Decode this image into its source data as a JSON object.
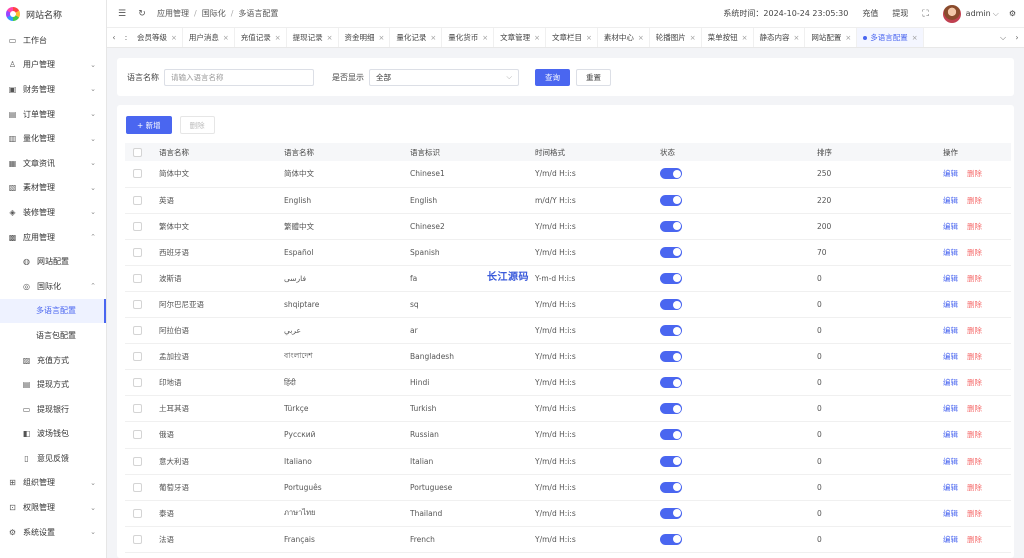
{
  "site_name": "网站名称",
  "sidebar": {
    "items": [
      {
        "label": "工作台",
        "icon": "desktop-icon",
        "glyph": "▭",
        "level": 0
      },
      {
        "label": "用户管理",
        "icon": "user-icon",
        "glyph": "♙",
        "level": 0,
        "arrow": "down"
      },
      {
        "label": "财务管理",
        "icon": "wallet-icon",
        "glyph": "▣",
        "level": 0,
        "arrow": "down"
      },
      {
        "label": "订单管理",
        "icon": "order-icon",
        "glyph": "▤",
        "level": 0,
        "arrow": "down"
      },
      {
        "label": "量化管理",
        "icon": "chart-icon",
        "glyph": "▥",
        "level": 0,
        "arrow": "down"
      },
      {
        "label": "文章资讯",
        "icon": "article-icon",
        "glyph": "▦",
        "level": 0,
        "arrow": "down"
      },
      {
        "label": "素材管理",
        "icon": "image-icon",
        "glyph": "▧",
        "level": 0,
        "arrow": "down"
      },
      {
        "label": "装修管理",
        "icon": "decor-icon",
        "glyph": "◈",
        "level": 0,
        "arrow": "down"
      },
      {
        "label": "应用管理",
        "icon": "app-icon",
        "glyph": "▩",
        "level": 0,
        "arrow": "up"
      },
      {
        "label": "网站配置",
        "icon": "globe-icon",
        "glyph": "◍",
        "level": 1
      },
      {
        "label": "国际化",
        "icon": "language-icon",
        "glyph": "◎",
        "level": 1,
        "arrow": "up"
      },
      {
        "label": "多语言配置",
        "level": 2,
        "active": true
      },
      {
        "label": "语言包配置",
        "level": 2
      },
      {
        "label": "充值方式",
        "icon": "recharge-icon",
        "glyph": "▨",
        "level": 1
      },
      {
        "label": "提现方式",
        "icon": "withdraw-icon",
        "glyph": "▤",
        "level": 1
      },
      {
        "label": "提现银行",
        "icon": "bank-icon",
        "glyph": "▭",
        "level": 1
      },
      {
        "label": "波场钱包",
        "icon": "purse-icon",
        "glyph": "◧",
        "level": 1
      },
      {
        "label": "意见反馈",
        "icon": "feedback-icon",
        "glyph": "▯",
        "level": 1
      },
      {
        "label": "组织管理",
        "icon": "org-icon",
        "glyph": "⊞",
        "level": 0,
        "arrow": "down"
      },
      {
        "label": "权限管理",
        "icon": "lock-icon",
        "glyph": "⊡",
        "level": 0,
        "arrow": "down"
      },
      {
        "label": "系统设置",
        "icon": "gear-icon",
        "glyph": "⚙",
        "level": 0,
        "arrow": "down"
      }
    ]
  },
  "header": {
    "breadcrumb": [
      "应用管理",
      "国际化",
      "多语言配置"
    ],
    "system_time": "系统时间：2024-10-24 23:05:30",
    "recharge": "充值",
    "withdraw": "提现",
    "user": "admin"
  },
  "tabs": [
    {
      "label": "会员等级"
    },
    {
      "label": "用户消息"
    },
    {
      "label": "充值记录"
    },
    {
      "label": "提现记录"
    },
    {
      "label": "资金明细"
    },
    {
      "label": "量化记录"
    },
    {
      "label": "量化货币"
    },
    {
      "label": "文章管理"
    },
    {
      "label": "文章栏目"
    },
    {
      "label": "素材中心"
    },
    {
      "label": "轮播图片"
    },
    {
      "label": "菜单按钮"
    },
    {
      "label": "静态内容"
    },
    {
      "label": "网站配置"
    },
    {
      "label": "多语言配置",
      "active": true
    }
  ],
  "filter": {
    "name_label": "语言名称",
    "name_placeholder": "请输入语言名称",
    "show_label": "是否显示",
    "show_value": "全部",
    "search_label": "查询",
    "reset_label": "重置"
  },
  "toolbar": {
    "add_label": "+ 新增",
    "delete_label": "删除"
  },
  "table": {
    "columns": [
      "语言名称",
      "语言名称",
      "语言标识",
      "时间格式",
      "状态",
      "排序",
      "操作"
    ],
    "edit_label": "编辑",
    "delete_label": "删除",
    "rows": [
      {
        "name": "简体中文",
        "native": "简体中文",
        "code": "Chinese1",
        "format": "Y/m/d H:i:s",
        "enabled": true,
        "sort": "250"
      },
      {
        "name": "英语",
        "native": "English",
        "code": "English",
        "format": "m/d/Y H:i:s",
        "enabled": true,
        "sort": "220"
      },
      {
        "name": "繁体中文",
        "native": "繁體中文",
        "code": "Chinese2",
        "format": "Y/m/d H:i:s",
        "enabled": true,
        "sort": "200"
      },
      {
        "name": "西班牙语",
        "native": "Español",
        "code": "Spanish",
        "format": "Y/m/d H:i:s",
        "enabled": true,
        "sort": "70"
      },
      {
        "name": "波斯语",
        "native": "فارسی",
        "code": "fa",
        "format": "Y-m-d H:i:s",
        "enabled": true,
        "sort": "0"
      },
      {
        "name": "阿尔巴尼亚语",
        "native": "shqiptare",
        "code": "sq",
        "format": "Y/m/d H:i:s",
        "enabled": true,
        "sort": "0"
      },
      {
        "name": "阿拉伯语",
        "native": "عربي",
        "code": "ar",
        "format": "Y/m/d H:i:s",
        "enabled": true,
        "sort": "0"
      },
      {
        "name": "孟加拉语",
        "native": "বাংলাদেশ",
        "code": "Bangladesh",
        "format": "Y/m/d H:i:s",
        "enabled": true,
        "sort": "0"
      },
      {
        "name": "印地语",
        "native": "हिंदी",
        "code": "Hindi",
        "format": "Y/m/d H:i:s",
        "enabled": true,
        "sort": "0"
      },
      {
        "name": "土耳其语",
        "native": "Türkçe",
        "code": "Turkish",
        "format": "Y/m/d H:i:s",
        "enabled": true,
        "sort": "0"
      },
      {
        "name": "俄语",
        "native": "Русский",
        "code": "Russian",
        "format": "Y/m/d H:i:s",
        "enabled": true,
        "sort": "0"
      },
      {
        "name": "意大利语",
        "native": "Italiano",
        "code": "Italian",
        "format": "Y/m/d H:i:s",
        "enabled": true,
        "sort": "0"
      },
      {
        "name": "葡萄牙语",
        "native": "Português",
        "code": "Portuguese",
        "format": "Y/m/d H:i:s",
        "enabled": true,
        "sort": "0"
      },
      {
        "name": "泰语",
        "native": "ภาษาไทย",
        "code": "Thailand",
        "format": "Y/m/d H:i:s",
        "enabled": true,
        "sort": "0"
      },
      {
        "name": "法语",
        "native": "Français",
        "code": "French",
        "format": "Y/m/d H:i:s",
        "enabled": true,
        "sort": "0"
      }
    ]
  },
  "watermark": "长江源码"
}
